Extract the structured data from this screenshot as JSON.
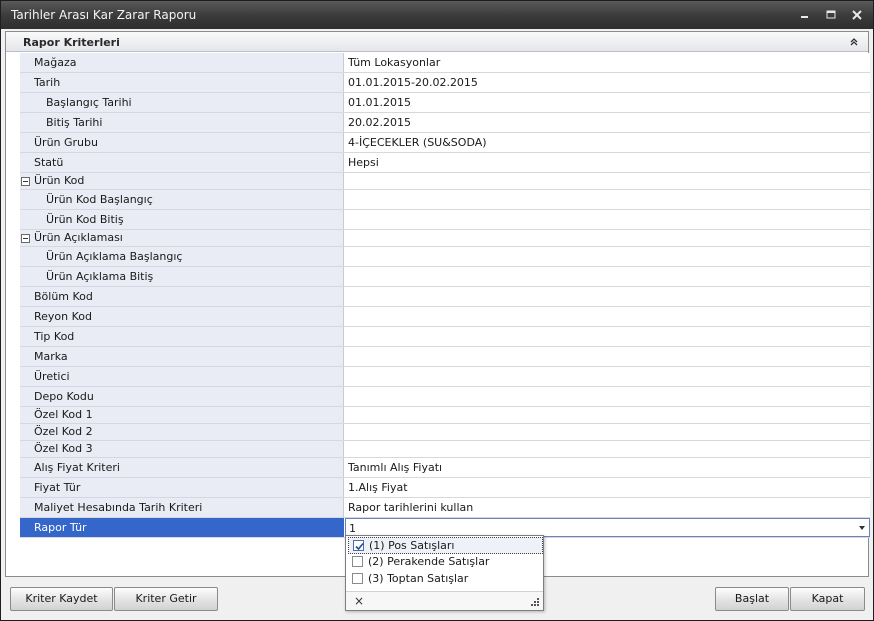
{
  "window": {
    "title": "Tarihler Arası Kar Zarar Raporu",
    "minimize_glyph": "_",
    "close_glyph": "X"
  },
  "group": {
    "title": "Rapor Kriterleri"
  },
  "rows": [
    {
      "label": "Mağaza",
      "value": "Tüm Lokasyonlar"
    },
    {
      "label": "Tarih",
      "value": "01.01.2015-20.02.2015"
    },
    {
      "label": "Başlangıç Tarihi",
      "value": "01.01.2015"
    },
    {
      "label": "Bitiş Tarihi",
      "value": "20.02.2015"
    },
    {
      "label": "Ürün Grubu",
      "value": "4-İÇECEKLER (SU&SODA)"
    },
    {
      "label": "Statü",
      "value": "Hepsi"
    },
    {
      "label": "Ürün Kod",
      "value": ""
    },
    {
      "label": "Ürün Kod Başlangıç",
      "value": ""
    },
    {
      "label": "Ürün Kod Bitiş",
      "value": ""
    },
    {
      "label": "Ürün Açıklaması",
      "value": ""
    },
    {
      "label": "Ürün Açıklama Başlangıç",
      "value": ""
    },
    {
      "label": "Ürün Açıklama Bitiş",
      "value": ""
    },
    {
      "label": "Bölüm Kod",
      "value": ""
    },
    {
      "label": "Reyon Kod",
      "value": ""
    },
    {
      "label": "Tip Kod",
      "value": ""
    },
    {
      "label": "Marka",
      "value": ""
    },
    {
      "label": "Üretici",
      "value": ""
    },
    {
      "label": "Depo Kodu",
      "value": ""
    },
    {
      "label": "Özel Kod 1",
      "value": ""
    },
    {
      "label": "Özel Kod 2",
      "value": ""
    },
    {
      "label": "Özel Kod 3",
      "value": ""
    },
    {
      "label": "Alış Fiyat Kriteri",
      "value": "Tanımlı Alış Fiyatı"
    },
    {
      "label": "Fiyat Tür",
      "value": "1.Alış Fiyat"
    },
    {
      "label": "Maliyet Hesabında Tarih Kriteri",
      "value": "Rapor tarihlerini kullan"
    },
    {
      "label": "Rapor Tür",
      "value": "1"
    }
  ],
  "dropdown": {
    "options": [
      {
        "label": "(1) Pos Satışları",
        "checked": true
      },
      {
        "label": "(2) Perakende Satışlar",
        "checked": false
      },
      {
        "label": "(3) Toptan Satışlar",
        "checked": false
      }
    ],
    "close_glyph": "×"
  },
  "buttons": {
    "save_criteria": "Kriter Kaydet",
    "load_criteria": "Kriter Getir",
    "start": "Başlat",
    "close": "Kapat"
  },
  "colors": {
    "selected_row": "#3467c9",
    "label_column": "#e9ecf5",
    "titlebar": "#3c3c3c"
  }
}
